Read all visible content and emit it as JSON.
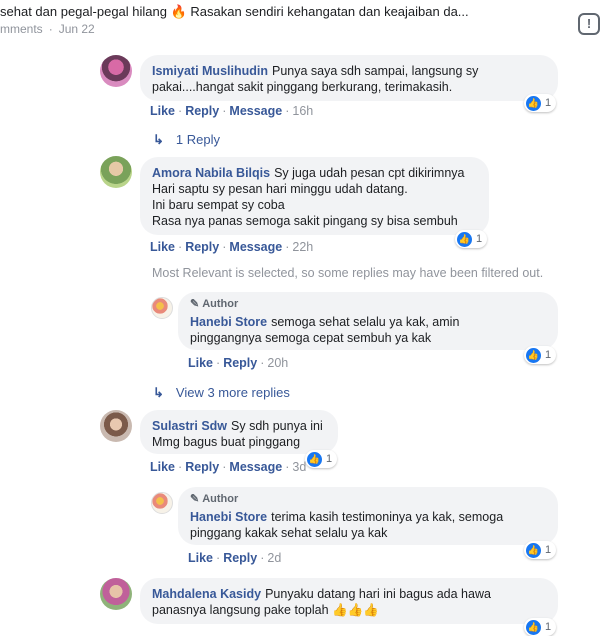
{
  "header": {
    "title": "sehat dan pegal-pegal hilang 🔥 Rasakan sendiri kehangatan dan keajaiban da...",
    "comments_label": "mments",
    "date": "Jun 22",
    "icon": "exclamation-icon"
  },
  "actions": {
    "like": "Like",
    "reply": "Reply",
    "message": "Message",
    "separator": "·"
  },
  "author_label": "Author",
  "comments": [
    {
      "name": "Ismiyati Muslihudin",
      "first_line": "Punya saya sdh sampai, langsung sy",
      "lines": [
        "pakai....hangat sakit pinggang berkurang, terimakasih."
      ],
      "time": "16h",
      "reactions": "1",
      "show_message": true
    },
    {
      "name": "Amora Nabila Bilqis",
      "first_line": "Sy juga udah pesan cpt dikirimnya",
      "lines": [
        "Hari saptu sy pesan hari minggu udah datang.",
        "Ini baru sempat sy coba",
        "Rasa nya panas semoga sakit pingang sy bisa sembuh"
      ],
      "time": "22h",
      "reactions": "1",
      "show_message": true
    },
    {
      "name": "Hanebi Store",
      "first_line": "semoga sehat selalu ya kak, amin",
      "lines": [
        "pinggangnya semoga cepat sembuh ya kak"
      ],
      "time": "20h",
      "reactions": "1",
      "show_message": false
    },
    {
      "name": "Sulastri Sdw",
      "first_line": "Sy sdh punya ini",
      "lines": [
        "Mmg bagus buat pinggang"
      ],
      "time": "3d",
      "reactions": "1",
      "show_message": true
    },
    {
      "name": "Hanebi Store",
      "first_line": "terima kasih testimoninya ya kak, semoga",
      "lines": [
        "pinggang kakak sehat selalu ya kak"
      ],
      "time": "2d",
      "reactions": "1",
      "show_message": false
    },
    {
      "name": "Mahdalena Kasidy",
      "first_line": "Punyaku datang hari ini bagus ada hawa",
      "lines": [
        "panasnya langsung pake toplah 👍👍👍"
      ],
      "time": "",
      "reactions": "1",
      "show_message": true
    }
  ],
  "replies_link_1": "1 Reply",
  "replies_link_2": "View 3 more replies",
  "filter_notice": "Most Relevant is selected, so some replies may have been filtered out.",
  "colors": {
    "link": "#385898",
    "bubble": "#f2f3f5",
    "meta": "#90949c",
    "like": "#1877f2"
  }
}
